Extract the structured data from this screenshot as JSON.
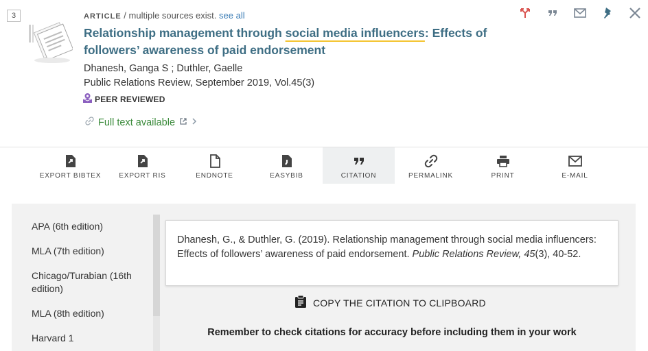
{
  "record": {
    "number": "3",
    "type": "ARTICLE",
    "sources_text": "/ multiple sources exist.",
    "see_all": "see all",
    "title_part1": "Relationship management through ",
    "title_highlight": "social media influencers",
    "title_part2": ": Effects of followers’ awareness of paid endorsement",
    "authors": "Dhanesh, Ganga S ; Duthler, Gaelle",
    "source": "Public Relations Review, September 2019, Vol.45(3)",
    "peer_reviewed": "PEER REVIEWED",
    "full_text": "Full text available"
  },
  "top_actions": [
    {
      "icon": "virtual-browse-icon"
    },
    {
      "icon": "quote-icon"
    },
    {
      "icon": "email-icon"
    },
    {
      "icon": "pin-icon"
    },
    {
      "icon": "close-icon"
    }
  ],
  "toolbar": {
    "export_bibtex": "EXPORT BIBTEX",
    "export_ris": "EXPORT RIS",
    "endnote": "ENDNOTE",
    "easybib": "EASYBIB",
    "citation": "CITATION",
    "permalink": "PERMALINK",
    "print": "PRINT",
    "email": "E-MAIL"
  },
  "citation_styles": [
    "APA (6th edition)",
    "MLA (7th edition)",
    "Chicago/Turabian (16th edition)",
    "MLA (8th edition)",
    "Harvard 1"
  ],
  "citation": {
    "text_plain": "Dhanesh, G., & Duthler, G. (2019). Relationship management through social media influencers: Effects of followers’ awareness of paid endorsement. ",
    "journal": "Public Relations Review,",
    "space": " ",
    "volume": "45",
    "issue_pages": "(3), 40-52."
  },
  "copy_label": "COPY THE CITATION TO CLIPBOARD",
  "reminder": "Remember to check citations for accuracy before including them in your work",
  "colors": {
    "title": "#3e6e84",
    "accent_red": "#d9534f",
    "full_text_green": "#3a8a3a",
    "peer_purple": "#8b5fbf",
    "highlight": "#f4c430"
  }
}
